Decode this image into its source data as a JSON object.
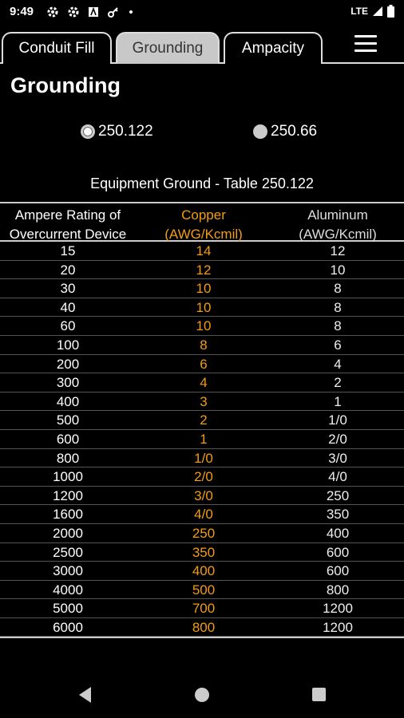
{
  "status_bar": {
    "time": "9:49",
    "network": "LTE"
  },
  "tabs": [
    {
      "label": "Conduit Fill"
    },
    {
      "label": "Grounding"
    },
    {
      "label": "Ampacity"
    }
  ],
  "page_title": "Grounding",
  "radio_options": [
    {
      "label": "250.122",
      "selected": true
    },
    {
      "label": "250.66",
      "selected": false
    }
  ],
  "table": {
    "title": "Equipment Ground - Table 250.122",
    "headers": {
      "col1_line1": "Ampere Rating of",
      "col1_line2": "Overcurrent Device",
      "col2_line1": "Copper",
      "col2_line2": "(AWG/Kcmil)",
      "col3_line1": "Aluminum",
      "col3_line2": "(AWG/Kcmil)"
    },
    "rows": [
      [
        "15",
        "14",
        "12"
      ],
      [
        "20",
        "12",
        "10"
      ],
      [
        "30",
        "10",
        "8"
      ],
      [
        "40",
        "10",
        "8"
      ],
      [
        "60",
        "10",
        "8"
      ],
      [
        "100",
        "8",
        "6"
      ],
      [
        "200",
        "6",
        "4"
      ],
      [
        "300",
        "4",
        "2"
      ],
      [
        "400",
        "3",
        "1"
      ],
      [
        "500",
        "2",
        "1/0"
      ],
      [
        "600",
        "1",
        "2/0"
      ],
      [
        "800",
        "1/0",
        "3/0"
      ],
      [
        "1000",
        "2/0",
        "4/0"
      ],
      [
        "1200",
        "3/0",
        "250"
      ],
      [
        "1600",
        "4/0",
        "350"
      ],
      [
        "2000",
        "250",
        "400"
      ],
      [
        "2500",
        "350",
        "600"
      ],
      [
        "3000",
        "400",
        "600"
      ],
      [
        "4000",
        "500",
        "800"
      ],
      [
        "5000",
        "700",
        "1200"
      ],
      [
        "6000",
        "800",
        "1200"
      ]
    ]
  },
  "colors": {
    "accent": "#f39c12",
    "background": "#000000",
    "tab_active": "#c8c8c8"
  }
}
